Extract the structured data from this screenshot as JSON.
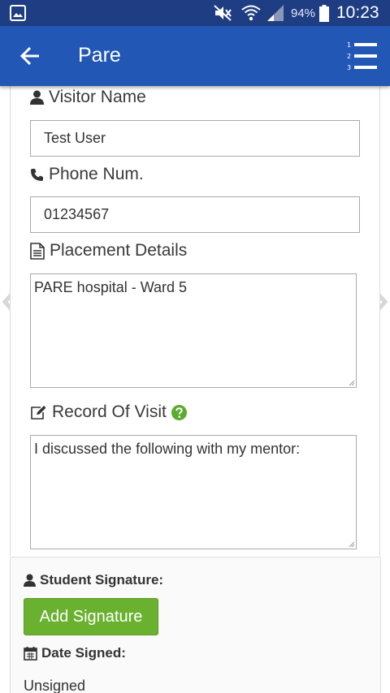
{
  "status_bar": {
    "battery_percent": "94%",
    "time": "10:23",
    "icons": [
      "gallery-icon",
      "mute-icon",
      "wifi-icon",
      "signal-icon",
      "battery-icon"
    ]
  },
  "app_bar": {
    "title": "Pare",
    "back_icon": "arrow-left-icon",
    "menu_icon": "numbered-list-icon"
  },
  "form": {
    "visitor_name": {
      "label": "Visitor Name",
      "value": "Test User",
      "icon": "user-icon"
    },
    "phone": {
      "label": "Phone Num.",
      "value": "01234567",
      "icon": "phone-icon"
    },
    "placement": {
      "label": "Placement Details",
      "value": "PARE hospital - Ward 5",
      "icon": "document-icon"
    },
    "record": {
      "label": "Record Of Visit",
      "value": "I discussed the following with my mentor:",
      "icon": "edit-icon",
      "help_icon": "question-circle-icon"
    }
  },
  "signature": {
    "student_label": "Student Signature:",
    "add_button": "Add Signature",
    "date_label": "Date Signed:",
    "date_value": "Unsigned"
  },
  "colors": {
    "status_bar": "#1f3d82",
    "app_bar": "#2257b5",
    "add_button": "#6ab12f",
    "help_icon": "#5aab2e"
  }
}
